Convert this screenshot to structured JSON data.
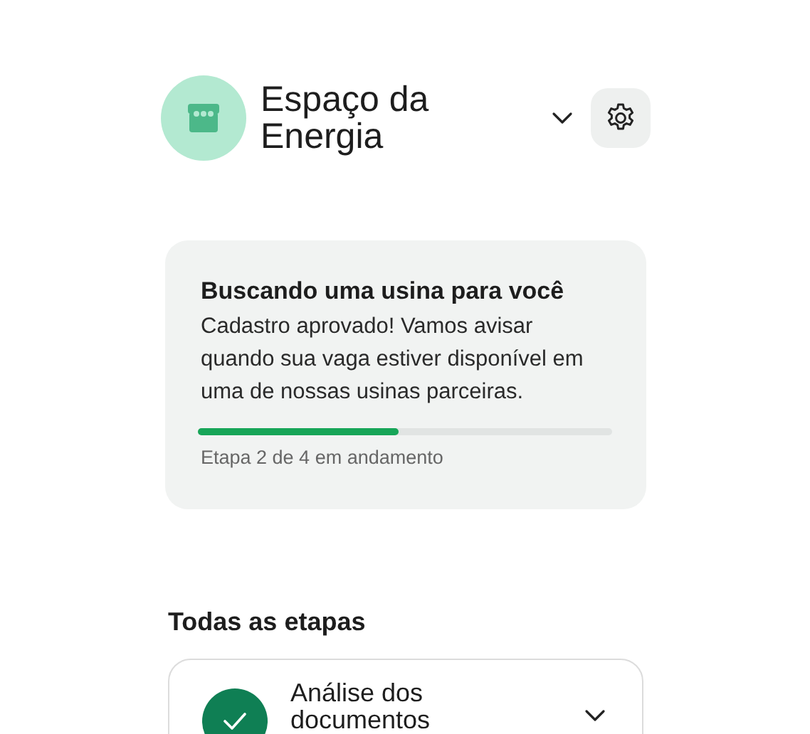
{
  "header": {
    "title": "Espaço da Energia"
  },
  "status_card": {
    "title": "Buscando uma usina para você",
    "message": "Cadastro aprovado! Vamos avisar quando sua vaga estiver disponível em uma de nossas usinas parceiras.",
    "level": 0.485,
    "caption": "Etapa 2 de 4 em andamento"
  },
  "steps_section": {
    "heading": "Todas as etapas",
    "steps": [
      {
        "title": "Análise dos documentos",
        "kind": "done",
        "expanded": false
      }
    ]
  }
}
